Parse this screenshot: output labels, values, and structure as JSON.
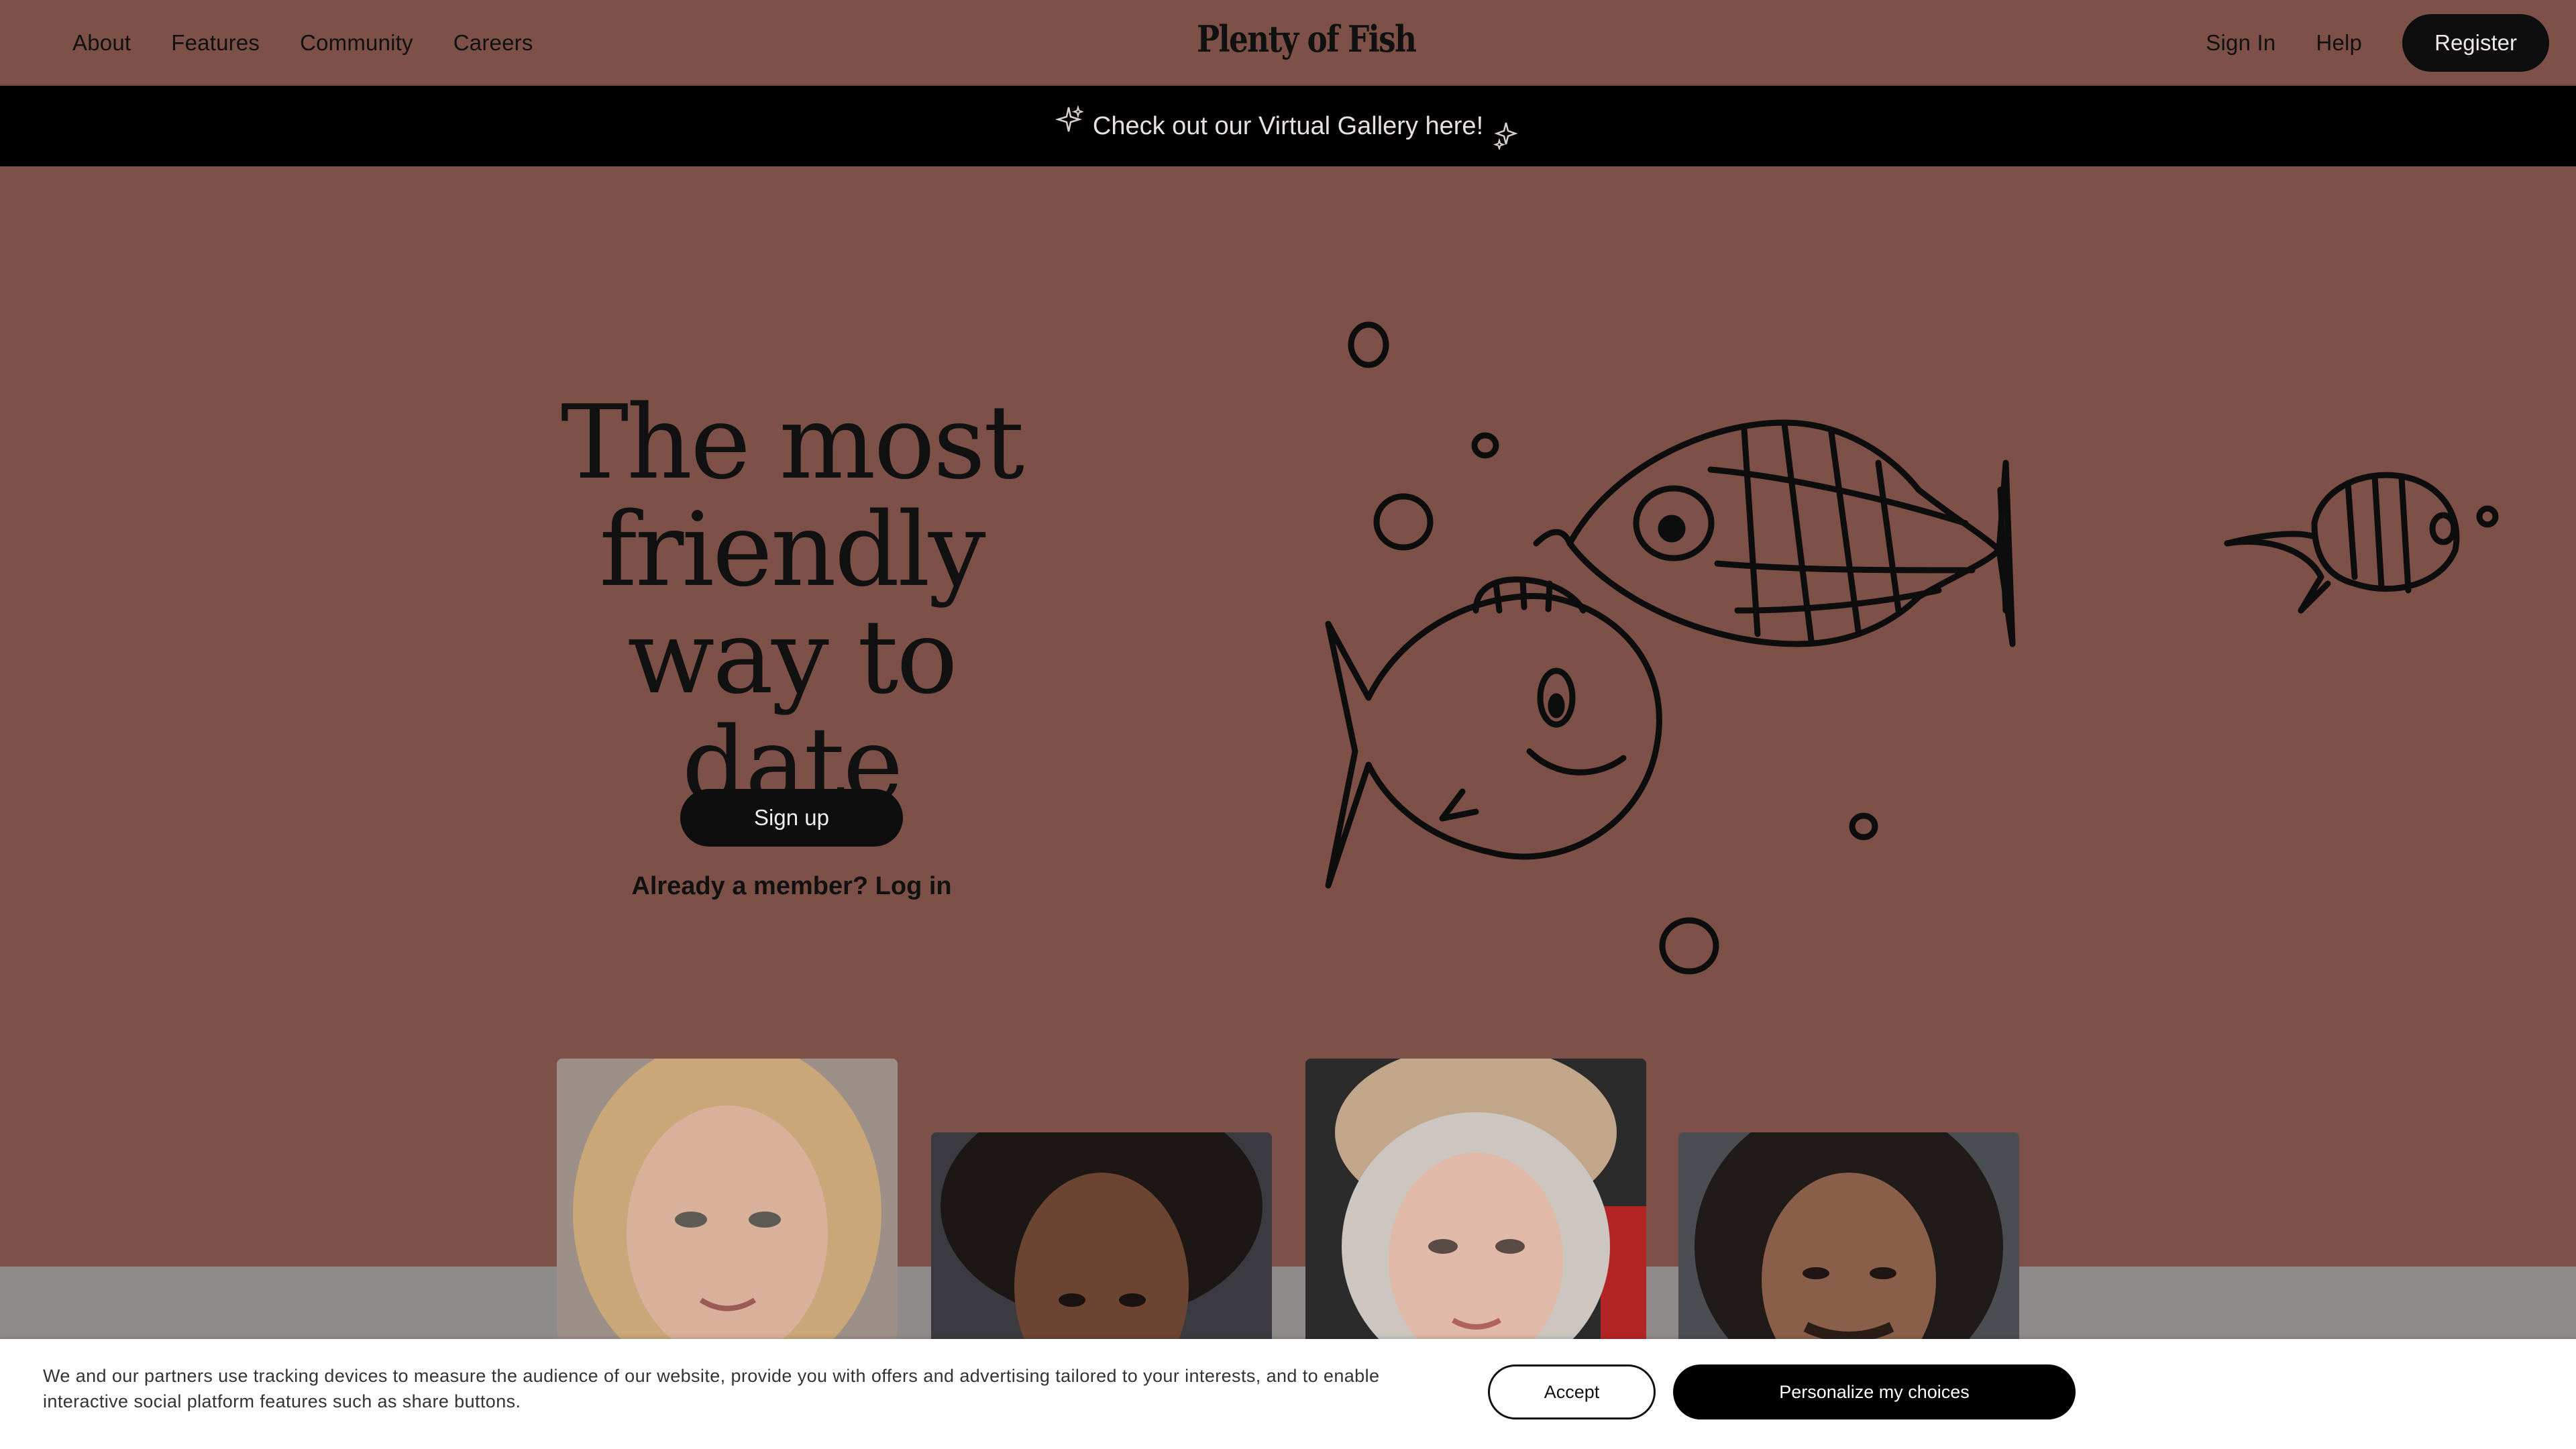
{
  "nav": {
    "links": [
      "About",
      "Features",
      "Community",
      "Careers"
    ],
    "logo": "Plenty of Fish",
    "sign_in": "Sign In",
    "help": "Help",
    "register": "Register"
  },
  "promo": {
    "text": "Check out our Virtual Gallery here!"
  },
  "hero": {
    "title_lines": [
      "The most",
      "friendly",
      "way to date"
    ],
    "signup": "Sign up",
    "member_link": "Already a member? Log in"
  },
  "cookie": {
    "text": "We and our partners use tracking devices to measure the audience of our website, provide you with offers and advertising tailored to your interests, and to enable interactive social platform features such as share buttons.",
    "accept": "Accept",
    "personalize": "Personalize my choices"
  },
  "colors": {
    "background": "#7d5148",
    "banner": "#000000",
    "button": "#0e0e0e",
    "grey_strip": "#8f8b8a"
  },
  "icons": [
    "sparkle-icon",
    "fish-illustration"
  ]
}
